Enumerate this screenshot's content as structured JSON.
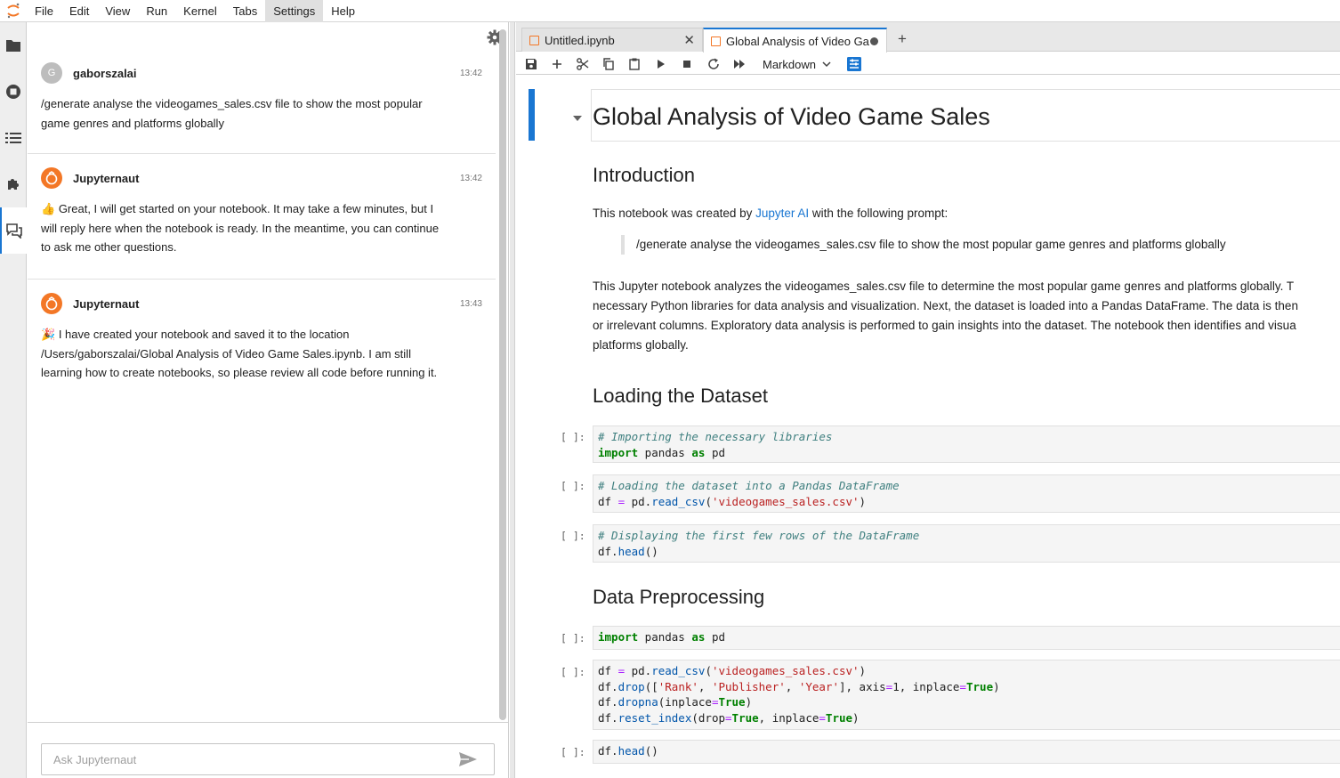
{
  "menu": [
    "File",
    "Edit",
    "View",
    "Run",
    "Kernel",
    "Tabs",
    "Settings",
    "Help"
  ],
  "menu_active": "Settings",
  "chat": {
    "messages": [
      {
        "author": "gaborszalai",
        "avatar_letter": "G",
        "time": "13:42",
        "lines": [
          "/generate analyse the videogames_sales.csv file to show the most popular",
          "game genres and platforms globally"
        ]
      },
      {
        "author": "Jupyternaut",
        "time": "13:42",
        "emoji": "👍",
        "lines": [
          "Great, I will get started on your notebook. It may take a few minutes, but I",
          "will reply here when the notebook is ready. In the meantime, you can continue",
          "to ask me other questions."
        ]
      },
      {
        "author": "Jupyternaut",
        "time": "13:43",
        "emoji": "🎉",
        "lines": [
          "I have created your notebook and saved it to the location",
          "/Users/gaborszalai/Global Analysis of Video Game Sales.ipynb. I am still",
          "learning how to create notebooks, so please review all code before running it."
        ]
      }
    ],
    "input_placeholder": "Ask Jupyternaut"
  },
  "tabs": [
    {
      "label": "Untitled.ipynb"
    },
    {
      "label": "Global Analysis of Video Ga"
    }
  ],
  "toolbar": {
    "cell_type": "Markdown"
  },
  "notebook": {
    "title": "Global Analysis of Video Game Sales",
    "intro_heading": "Introduction",
    "intro_text_before": "This notebook was created by ",
    "intro_link": "Jupyter AI",
    "intro_text_after": " with the following prompt:",
    "quote": "/generate analyse the videogames_sales.csv file to show the most popular game genres and platforms globally",
    "paragraph": [
      "This Jupyter notebook analyzes the videogames_sales.csv file to determine the most popular game genres and platforms globally. T",
      "necessary Python libraries for data analysis and visualization. Next, the dataset is loaded into a Pandas DataFrame. The data is then",
      "or irrelevant columns. Exploratory data analysis is performed to gain insights into the dataset. The notebook then identifies and visua",
      "platforms globally."
    ],
    "loading_heading": "Loading the Dataset",
    "preprocessing_heading": "Data Preprocessing",
    "prompt": "[ ]:",
    "code": {
      "c1_comment": "# Importing the necessary libraries",
      "c2_comment": "# Loading the dataset into a Pandas DataFrame",
      "c3_comment": "# Displaying the first few rows of the DataFrame"
    }
  }
}
